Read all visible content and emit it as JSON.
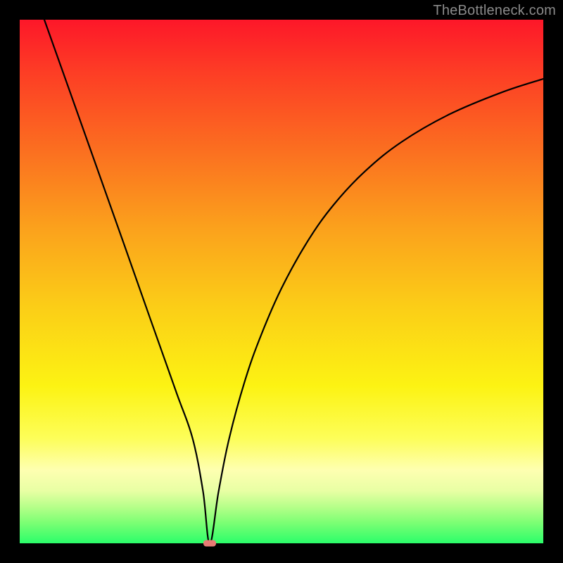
{
  "watermark": "TheBottleneck.com",
  "colors": {
    "frame": "#000000",
    "curve": "#000000",
    "marker": "#e87a74",
    "watermark": "#8a8a8a",
    "gradient_top": "#fd1729",
    "gradient_bottom": "#2bfd6a"
  },
  "chart_data": {
    "type": "line",
    "title": "",
    "xlabel": "",
    "ylabel": "",
    "xlim": [
      0,
      100
    ],
    "ylim": [
      0,
      100
    ],
    "grid": false,
    "legend": false,
    "annotations": [
      "TheBottleneck.com"
    ],
    "minimum_marker": {
      "x": 36.3,
      "y": 0,
      "color": "#e87a74"
    },
    "series": [
      {
        "name": "bottleneck-curve",
        "x": [
          4.7,
          10,
          15,
          20,
          25,
          30,
          33,
          35,
          36.3,
          38,
          40,
          43,
          46,
          50,
          55,
          60,
          66,
          73,
          82,
          92,
          100
        ],
        "y": [
          100,
          85.1,
          71,
          56.9,
          42.7,
          28.6,
          20.1,
          10,
          0,
          10,
          20,
          31,
          39.5,
          48.7,
          57.7,
          64.7,
          71.1,
          76.7,
          81.9,
          86.1,
          88.7
        ]
      }
    ]
  }
}
